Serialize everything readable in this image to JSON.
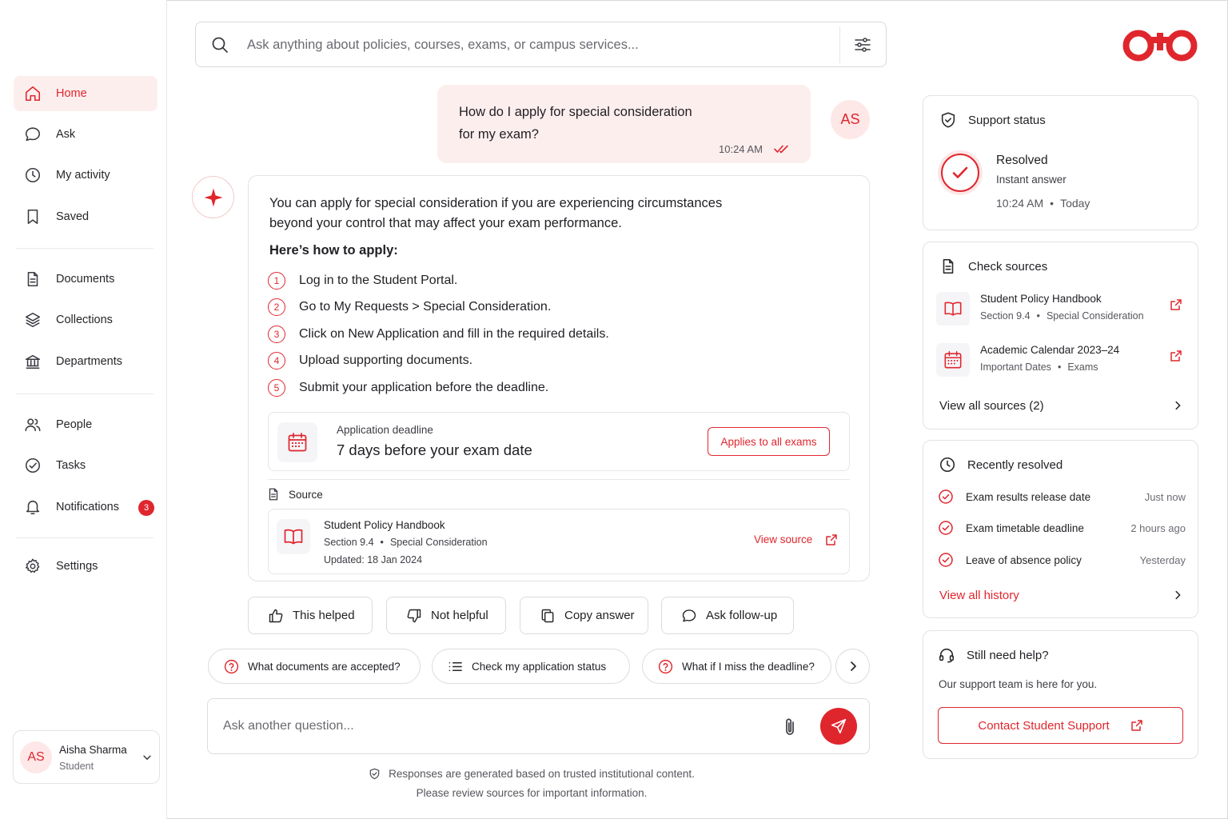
{
  "sidebar": {
    "items": [
      {
        "label": "Home",
        "icon": "home-icon",
        "active": true
      },
      {
        "label": "Ask",
        "icon": "chat-bubble-icon"
      },
      {
        "label": "My activity",
        "icon": "clock-icon"
      },
      {
        "label": "Saved",
        "icon": "bookmark-icon"
      },
      {
        "label": "Documents",
        "icon": "document-icon"
      },
      {
        "label": "Collections",
        "icon": "layers-icon"
      },
      {
        "label": "Departments",
        "icon": "building-icon"
      },
      {
        "label": "People",
        "icon": "people-icon"
      },
      {
        "label": "Tasks",
        "icon": "check-circle-icon"
      },
      {
        "label": "Notifications",
        "icon": "bell-icon",
        "badge": "3"
      },
      {
        "label": "Settings",
        "icon": "gear-icon"
      }
    ],
    "user": {
      "initials": "AS",
      "name": "Aisha Sharma",
      "role": "Student"
    }
  },
  "search": {
    "placeholder": "Ask anything about policies, courses, exams, or campus services..."
  },
  "chat": {
    "user_message": {
      "line1": "How do I apply for special consideration",
      "line2": "for my exam?",
      "time": "10:24 AM",
      "avatar": "AS"
    },
    "answer": {
      "intro_line1": "You can apply for special consideration if you are experiencing circumstances",
      "intro_line2": "beyond your control that may affect your exam performance.",
      "howto": "Here’s how to apply:",
      "steps": [
        {
          "num": "1",
          "text": "Log in to the Student Portal."
        },
        {
          "num": "2",
          "text": "Go to My Requests > Special Consideration."
        },
        {
          "num": "3",
          "text": "Click on New Application and fill in the required details."
        },
        {
          "num": "4",
          "text": "Upload supporting documents."
        },
        {
          "num": "5",
          "text": "Submit your application before the deadline."
        }
      ],
      "deadline": {
        "label": "Application deadline",
        "value": "7 days before your exam date",
        "badge": "Applies to all exams"
      },
      "source_label": "Source",
      "source": {
        "title": "Student Policy Handbook",
        "section": "Section 9.4",
        "topic": "Special Consideration",
        "updated": "Updated: 18 Jan 2024",
        "link": "View source"
      }
    },
    "feedback": [
      "This helped",
      "Not helpful",
      "Copy answer",
      "Ask follow-up"
    ],
    "suggestions": [
      "What documents are accepted?",
      "Check my application status",
      "What if I miss the deadline?"
    ],
    "composer_placeholder": "Ask another question...",
    "disclaimer_line1": "Responses are generated based on trusted institutional content.",
    "disclaimer_line2": "Please review sources for important information."
  },
  "right_panel": {
    "support": {
      "title": "Support status",
      "status": "Resolved",
      "detail": "Instant answer",
      "time": "10:24 AM",
      "day": "Today"
    },
    "sources": {
      "title": "Check sources",
      "items": [
        {
          "name": "Student Policy Handbook",
          "meta1": "Section 9.4",
          "meta2": "Special Consideration"
        },
        {
          "name": "Academic Calendar 2023–24",
          "meta1": "Important Dates",
          "meta2": "Exams"
        }
      ],
      "view_all": "View all sources (2)"
    },
    "history": {
      "title": "Recently resolved",
      "items": [
        {
          "title": "Exam results release date",
          "when": "Just now"
        },
        {
          "title": "Exam timetable deadline",
          "when": "2 hours ago"
        },
        {
          "title": "Leave of absence policy",
          "when": "Yesterday"
        }
      ],
      "view_all": "View all history"
    },
    "help": {
      "title": "Still need help?",
      "subtitle": "Our support team is here for you.",
      "button": "Contact Student Support"
    }
  },
  "colors": {
    "accent": "#e0262d",
    "accent_light": "#fdeeee",
    "text": "#1f1f24",
    "border": "#e3e3e8"
  }
}
